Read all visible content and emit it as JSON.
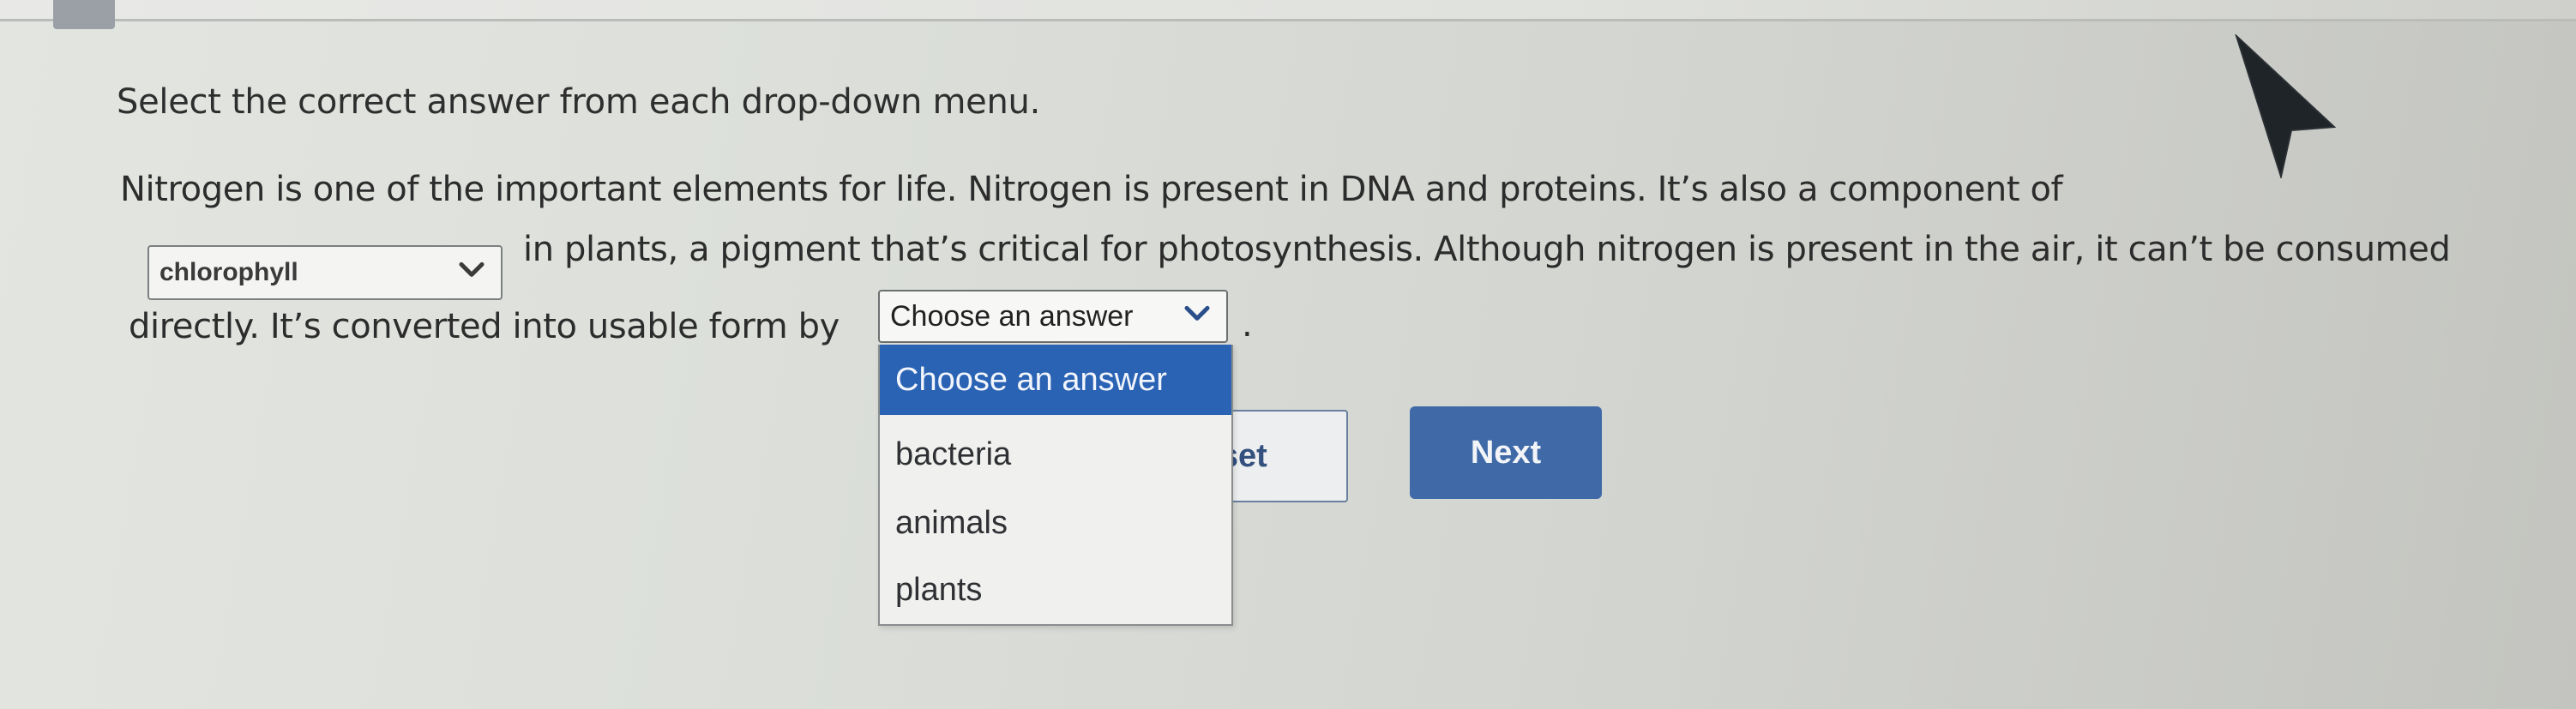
{
  "instruction": "Select the correct answer from each drop-down menu.",
  "passage": {
    "line1": "Nitrogen is one of the important elements for life. Nitrogen is present in DNA and proteins. It’s also a component of",
    "line2": "in plants, a pigment that’s critical for photosynthesis. Although nitrogen is present in the air, it can’t be consumed",
    "line3": "directly. It’s converted into usable form by",
    "period": "."
  },
  "dropdown1": {
    "selected": "chlorophyll",
    "icon": "chevron-down-icon"
  },
  "dropdown2": {
    "selected": "Choose an answer",
    "icon": "chevron-down-icon",
    "options": [
      "Choose an answer",
      "bacteria",
      "animals",
      "plants"
    ],
    "highlighted_index": 0
  },
  "buttons": {
    "reset_label": "Reset",
    "next_label": "Next"
  },
  "colors": {
    "highlight": "#2a63b4",
    "next_button": "#3f69a7",
    "reset_text": "#33507f"
  }
}
